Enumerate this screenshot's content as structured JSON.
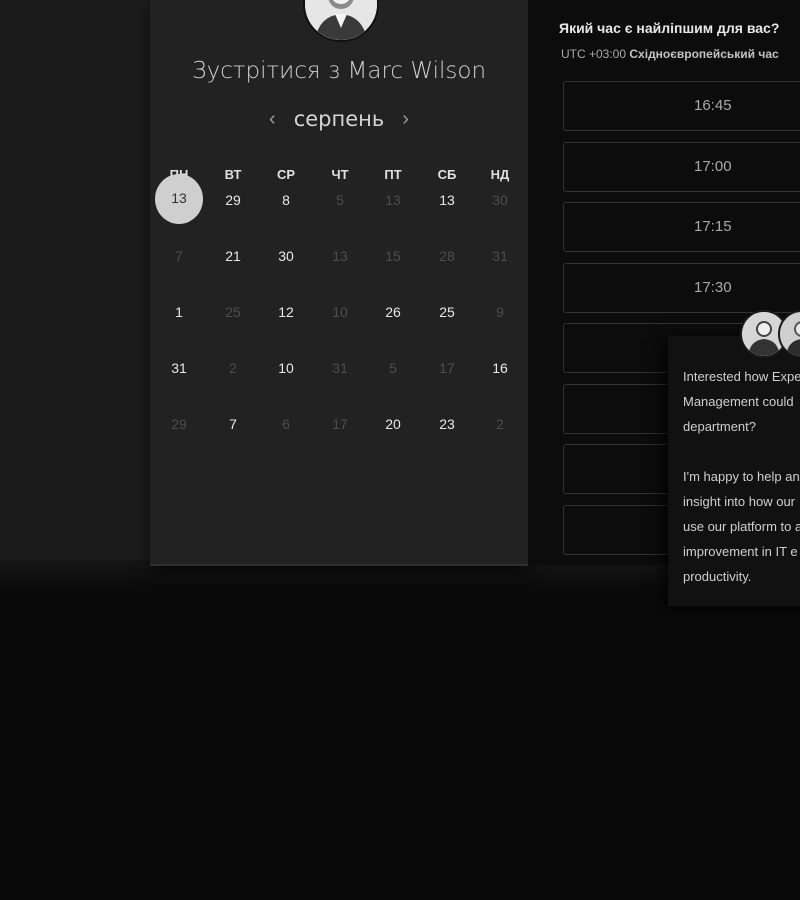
{
  "calendar": {
    "title": "Зустрітися з Marc Wilson",
    "month": "серпень",
    "prev_icon": "chevron-left-icon",
    "next_icon": "chevron-right-icon",
    "weekdays": [
      "ПН",
      "ВТ",
      "СР",
      "ЧТ",
      "ПТ",
      "СБ",
      "НД"
    ],
    "weeks": [
      [
        {
          "d": "13",
          "on": true,
          "sel": true
        },
        {
          "d": "29",
          "on": true
        },
        {
          "d": "8",
          "on": true
        },
        {
          "d": "5",
          "on": false
        },
        {
          "d": "13",
          "on": false
        },
        {
          "d": "13",
          "on": true
        },
        {
          "d": "30",
          "on": false
        }
      ],
      [
        {
          "d": "7",
          "on": false
        },
        {
          "d": "21",
          "on": true
        },
        {
          "d": "30",
          "on": true
        },
        {
          "d": "13",
          "on": false
        },
        {
          "d": "15",
          "on": false
        },
        {
          "d": "28",
          "on": false
        },
        {
          "d": "31",
          "on": false
        }
      ],
      [
        {
          "d": "1",
          "on": true
        },
        {
          "d": "25",
          "on": false
        },
        {
          "d": "12",
          "on": true
        },
        {
          "d": "10",
          "on": false
        },
        {
          "d": "26",
          "on": true
        },
        {
          "d": "25",
          "on": true
        },
        {
          "d": "9",
          "on": false
        }
      ],
      [
        {
          "d": "31",
          "on": true
        },
        {
          "d": "2",
          "on": false
        },
        {
          "d": "10",
          "on": true
        },
        {
          "d": "31",
          "on": false
        },
        {
          "d": "5",
          "on": false
        },
        {
          "d": "17",
          "on": false
        },
        {
          "d": "16",
          "on": true
        }
      ],
      [
        {
          "d": "29",
          "on": false
        },
        {
          "d": "7",
          "on": true
        },
        {
          "d": "6",
          "on": false
        },
        {
          "d": "17",
          "on": false
        },
        {
          "d": "20",
          "on": true
        },
        {
          "d": "23",
          "on": true
        },
        {
          "d": "2",
          "on": false
        }
      ]
    ]
  },
  "times": {
    "question": "Який час є найліпшим для вас?",
    "timezone_prefix": "UTC +03:00",
    "timezone_name": "Східноєвропейський час",
    "slots": [
      "16:45",
      "17:00",
      "17:15",
      "17:30",
      "",
      "",
      "",
      ""
    ]
  },
  "chat": {
    "message": "Interested how Expe\nManagement could\ndepartment?\n\nI'm happy to help an\ninsight into how our\nuse our platform to a\nimprovement in IT e\nproductivity."
  }
}
